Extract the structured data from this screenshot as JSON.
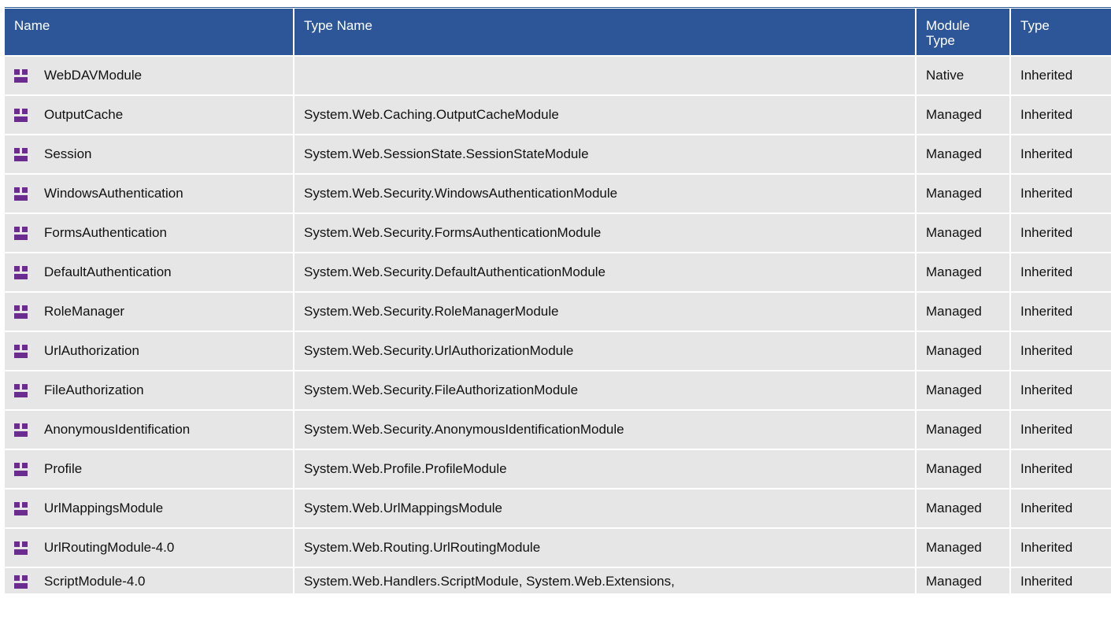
{
  "colors": {
    "header_bg": "#2d5699",
    "row_bg": "#e6e6e6",
    "icon": "#6b2c8f"
  },
  "icon_name": "module-icon",
  "columns": {
    "name": "Name",
    "type_name": "Type Name",
    "module_type_line1": "Module",
    "module_type_line2": "Type",
    "type": "Type"
  },
  "rows": [
    {
      "name": "WebDAVModule",
      "type_name": "",
      "module_type": "Native",
      "type": "Inherited"
    },
    {
      "name": "OutputCache",
      "type_name": "System.Web.Caching.OutputCacheModule",
      "module_type": "Managed",
      "type": "Inherited"
    },
    {
      "name": "Session",
      "type_name": "System.Web.SessionState.SessionStateModule",
      "module_type": "Managed",
      "type": "Inherited"
    },
    {
      "name": "WindowsAuthentication",
      "type_name": "System.Web.Security.WindowsAuthenticationModule",
      "module_type": "Managed",
      "type": "Inherited"
    },
    {
      "name": "FormsAuthentication",
      "type_name": "System.Web.Security.FormsAuthenticationModule",
      "module_type": "Managed",
      "type": "Inherited"
    },
    {
      "name": "DefaultAuthentication",
      "type_name": "System.Web.Security.DefaultAuthenticationModule",
      "module_type": "Managed",
      "type": "Inherited"
    },
    {
      "name": "RoleManager",
      "type_name": "System.Web.Security.RoleManagerModule",
      "module_type": "Managed",
      "type": "Inherited"
    },
    {
      "name": "UrlAuthorization",
      "type_name": "System.Web.Security.UrlAuthorizationModule",
      "module_type": "Managed",
      "type": "Inherited"
    },
    {
      "name": "FileAuthorization",
      "type_name": "System.Web.Security.FileAuthorizationModule",
      "module_type": "Managed",
      "type": "Inherited"
    },
    {
      "name": "AnonymousIdentification",
      "type_name": "System.Web.Security.AnonymousIdentificationModule",
      "module_type": "Managed",
      "type": "Inherited"
    },
    {
      "name": "Profile",
      "type_name": "System.Web.Profile.ProfileModule",
      "module_type": "Managed",
      "type": "Inherited"
    },
    {
      "name": "UrlMappingsModule",
      "type_name": "System.Web.UrlMappingsModule",
      "module_type": "Managed",
      "type": "Inherited"
    },
    {
      "name": "UrlRoutingModule-4.0",
      "type_name": "System.Web.Routing.UrlRoutingModule",
      "module_type": "Managed",
      "type": "Inherited"
    },
    {
      "name": "ScriptModule-4.0",
      "type_name": "System.Web.Handlers.ScriptModule, System.Web.Extensions,",
      "module_type": "Managed",
      "type": "Inherited"
    }
  ]
}
